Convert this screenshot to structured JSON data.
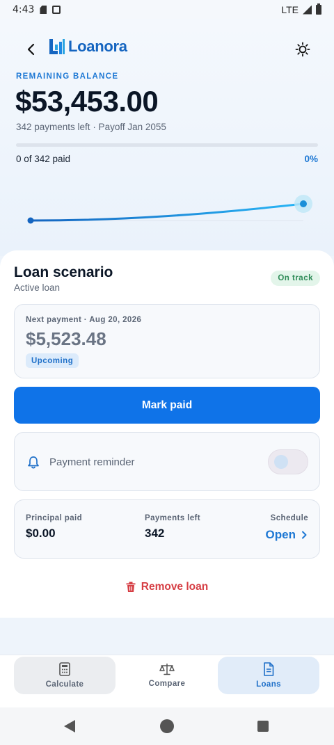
{
  "status_bar": {
    "time": "4:43",
    "network": "LTE",
    "icons": [
      "sd-card-icon",
      "screenshot-icon",
      "signal-icon",
      "battery-icon"
    ]
  },
  "header": {
    "app_name": "Loanora",
    "back_icon": "arrow-left-icon",
    "theme_icon": "sun-icon"
  },
  "balance": {
    "label": "REMAINING BALANCE",
    "amount": "$53,453.00",
    "subtitle": "342 payments left · Payoff Jan 2055",
    "paid_text": "0 of 342 paid",
    "paid_percent_text": "0%",
    "progress_fraction": 0
  },
  "scenario": {
    "title": "Loan scenario",
    "subtitle": "Active loan",
    "status_badge": "On track"
  },
  "next_payment": {
    "label": "Next payment · Aug 20, 2026",
    "amount": "$5,523.48",
    "badge": "Upcoming"
  },
  "actions": {
    "mark_paid": "Mark paid",
    "remove_loan": "Remove loan"
  },
  "reminder": {
    "label": "Payment reminder",
    "enabled": false
  },
  "stats": {
    "principal_label": "Principal paid",
    "principal_value": "$0.00",
    "payments_label": "Payments left",
    "payments_value": "342",
    "schedule_label": "Schedule",
    "schedule_link": "Open"
  },
  "bottom_nav": {
    "items": [
      {
        "label": "Calculate",
        "icon": "calculator-icon"
      },
      {
        "label": "Compare",
        "icon": "scale-icon"
      },
      {
        "label": "Loans",
        "icon": "document-icon",
        "active": true
      }
    ]
  },
  "colors": {
    "accent": "#0f73e8",
    "brand": "#1565c0",
    "success": "#2e8b57",
    "danger": "#d63e44"
  }
}
